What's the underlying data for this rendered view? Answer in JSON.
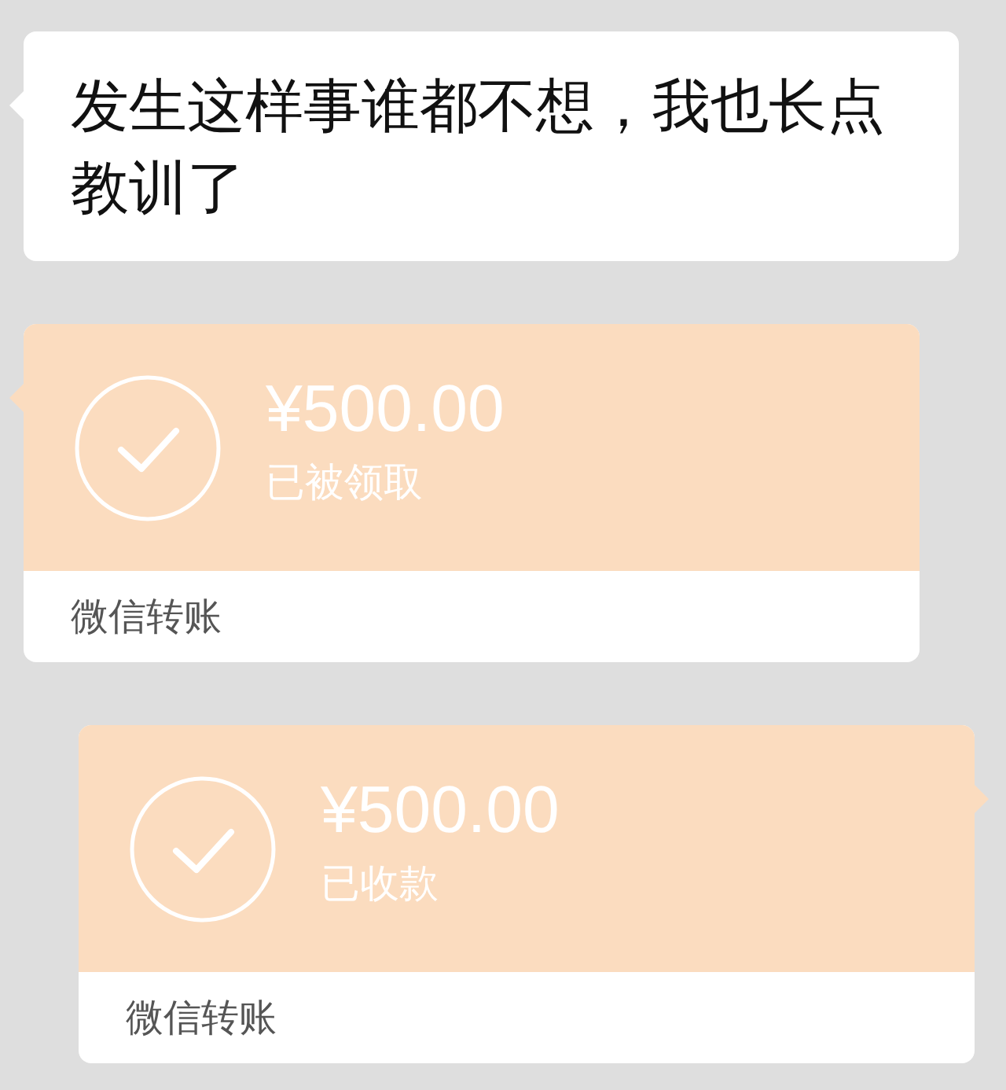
{
  "messages": [
    {
      "kind": "text",
      "outgoing": false,
      "text": "发生这样事谁都不想，我也长点教训了"
    },
    {
      "kind": "transfer",
      "outgoing": false,
      "amount": "¥500.00",
      "status": "已被领取",
      "footer": "微信转账"
    },
    {
      "kind": "transfer",
      "outgoing": true,
      "amount": "¥500.00",
      "status": "已收款",
      "footer": "微信转账"
    }
  ]
}
